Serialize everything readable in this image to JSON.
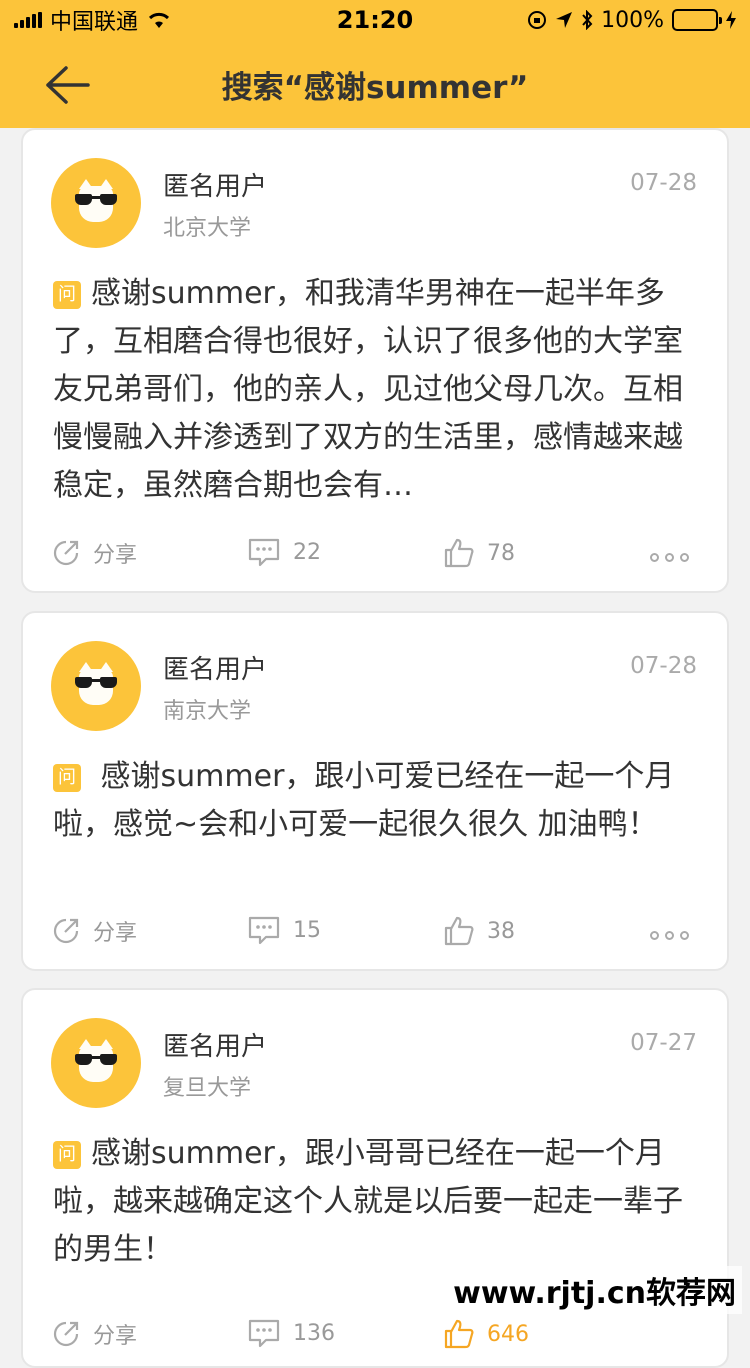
{
  "status_bar": {
    "carrier": "中国联通",
    "time": "21:20",
    "battery": "100%"
  },
  "nav": {
    "title": "搜索“感谢summer”"
  },
  "posts": [
    {
      "user": "匿名用户",
      "school": "北京大学",
      "date": "07-28",
      "badge": "问",
      "text": "感谢summer，和我清华男神在一起半年多了，互相磨合得也很好，认识了很多他的大学室友兄弟哥们，他的亲人，见过他父母几次。互相慢慢融入并渗透到了双方的生活里，感情越来越稳定，虽然磨合期也会有…",
      "share_label": "分享",
      "comments": "22",
      "likes": "78"
    },
    {
      "user": "匿名用户",
      "school": "南京大学",
      "date": "07-28",
      "badge": "问",
      "text": " 感谢summer，跟小可爱已经在一起一个月啦，感觉~会和小可爱一起很久很久  加油鸭！",
      "share_label": "分享",
      "comments": "15",
      "likes": "38"
    },
    {
      "user": "匿名用户",
      "school": "复旦大学",
      "date": "07-27",
      "badge": "问",
      "text": "感谢summer，跟小哥哥已经在一起一个月啦，越来越确定这个人就是以后要一起走一辈子的男生！",
      "share_label": "分享",
      "comments": "136",
      "likes": "646"
    }
  ],
  "colors": {
    "brand": "#fcc43a",
    "liked": "#f5a623"
  },
  "watermark": "www.rjtj.cn软荐网"
}
